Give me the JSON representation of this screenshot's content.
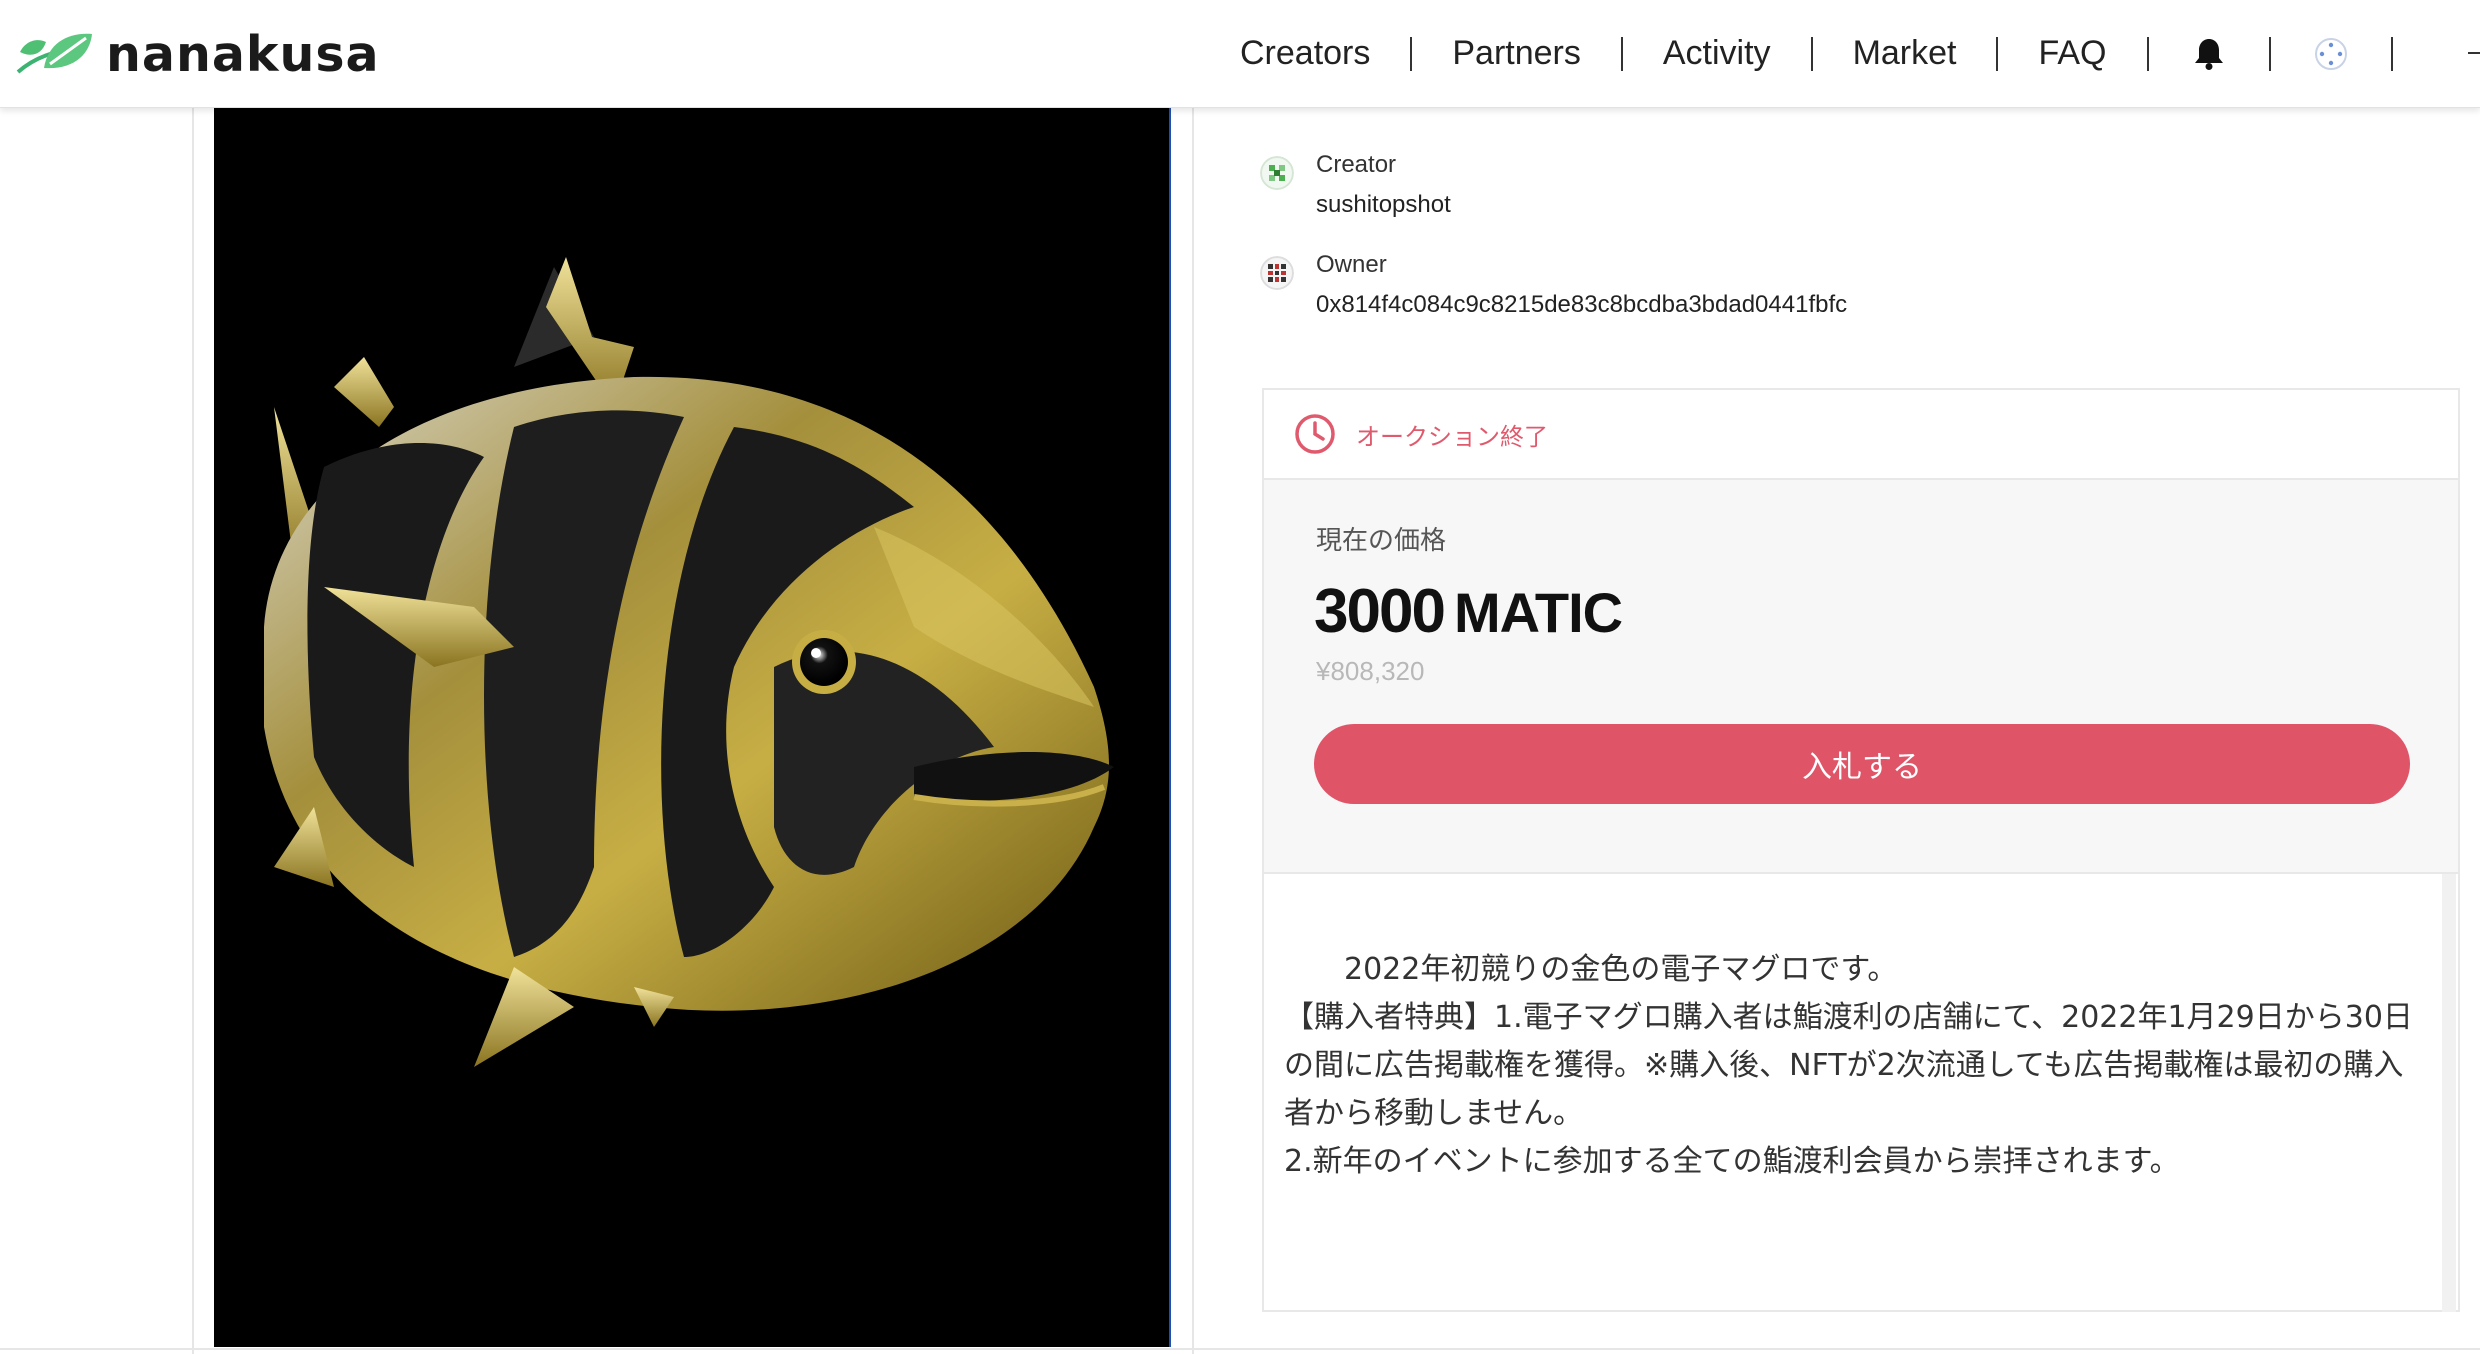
{
  "header": {
    "logo_text": "nanakusa",
    "nav": [
      "Creators",
      "Partners",
      "Activity",
      "Market",
      "FAQ"
    ],
    "icons": [
      "bell-icon",
      "wallet-avatar-icon"
    ]
  },
  "creator": {
    "label": "Creator",
    "value": "sushitopshot"
  },
  "owner": {
    "label": "Owner",
    "value": "0x814f4c084c9c8215de83c8bcdba3bdad0441fbfc"
  },
  "auction": {
    "status": "オークション終了",
    "price_label": "現在の価格",
    "price_amount": "3000",
    "price_unit": "MATIC",
    "price_yen": "¥808,320",
    "bid_button": "入札する"
  },
  "description": {
    "text": "　　2022年初競りの金色の電子マグロです。\n【購入者特典】1.電子マグロ購入者は鮨渡利の店舗にて、2022年1月29日から30日の間に広告掲載権を獲得。※購入後、NFTが2次流通しても広告掲載権は最初の購入者から移動しません。\n2.新年のイベントに参加する全ての鮨渡利会員から崇拝されます。"
  },
  "colors": {
    "accent": "#e05468",
    "status_red": "#e05a6d",
    "logo_green": "#3cb371",
    "art_background": "#000000",
    "tuna_gold": "#b49a2a"
  }
}
